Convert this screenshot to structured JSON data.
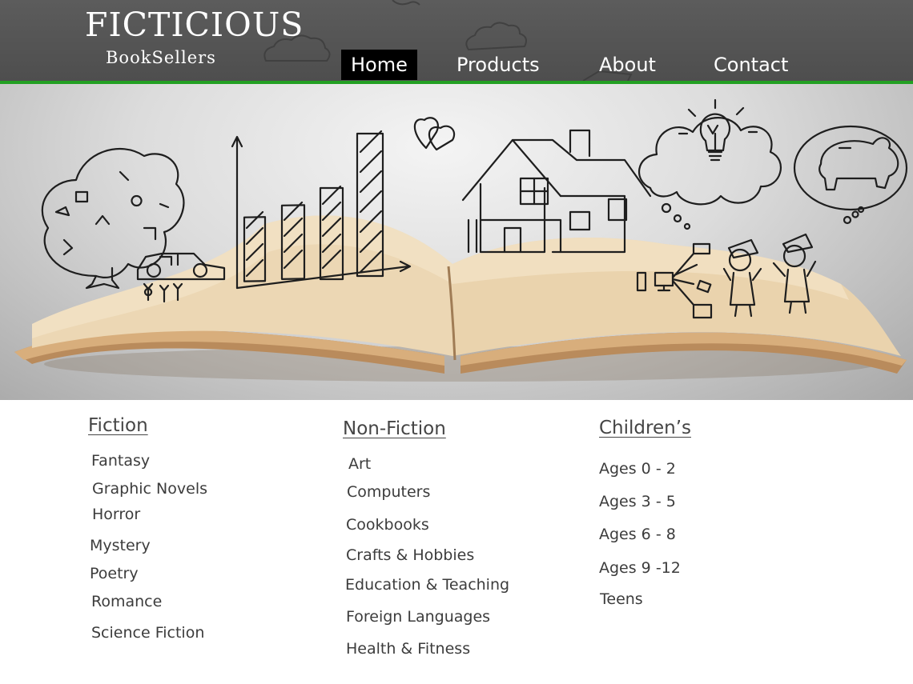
{
  "brand": {
    "title": "FICTICIOUS",
    "subtitle": "BookSellers"
  },
  "nav": {
    "items": [
      {
        "label": "Home",
        "active": true
      },
      {
        "label": "Products",
        "active": false
      },
      {
        "label": "About",
        "active": false
      },
      {
        "label": "Contact",
        "active": false
      }
    ]
  },
  "colors": {
    "header": "#555555",
    "accent_rule": "#23a023",
    "active_nav": "#000000",
    "text": "#3c3c3c"
  },
  "hero": {
    "icon": "open-book-doodles-image"
  },
  "categories": {
    "fiction": {
      "heading": "Fiction",
      "items": [
        "Fantasy",
        "Graphic Novels",
        "Horror",
        "Mystery",
        "Poetry",
        "Romance",
        "Science Fiction"
      ]
    },
    "nonfiction": {
      "heading": "Non-Fiction",
      "items": [
        "Art",
        "Computers",
        "Cookbooks",
        "Crafts & Hobbies",
        "Education & Teaching",
        "Foreign Languages",
        "Health & Fitness"
      ]
    },
    "childrens": {
      "heading": "Children’s",
      "items": [
        "Ages 0 - 2",
        "Ages 3 - 5",
        "Ages 6 - 8",
        "Ages 9 -12",
        "Teens"
      ]
    }
  }
}
